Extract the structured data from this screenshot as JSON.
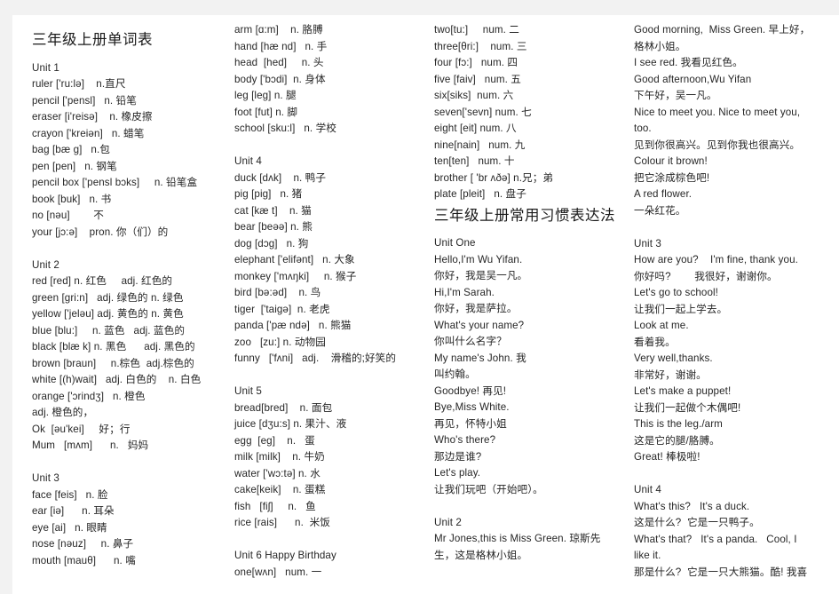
{
  "document": {
    "title_words": "三年级上册单词表",
    "title_phrases": "三年级上册常用习惯表达法"
  },
  "columns": {
    "col1": {
      "title": "三年级上册单词表",
      "blocks": [
        {
          "unit": "Unit 1",
          "lines": [
            "ruler ['ru:lə]    n.直尺",
            "pencil ['pensl]   n. 铅笔",
            "eraser [i'reisə]    n. 橡皮擦",
            "crayon ['kreiən]   n. 蜡笔",
            "bag [bæ g]   n.包",
            "pen [pen]   n. 钢笔",
            "pencil box ['pensl bɔks]     n. 铅笔盒",
            "book [buk]   n. 书",
            "no [nəu]        不",
            "your [jɔ:ə]    pron. 你（们）的"
          ]
        },
        {
          "unit": "Unit 2",
          "lines": [
            "red [red] n. 红色     adj. 红色的",
            "green [gri:n]   adj. 绿色的 n. 绿色",
            "yellow ['jeləu] adj. 黄色的 n. 黄色",
            "blue [blu:]     n. 蓝色   adj. 蓝色的",
            "black [blæ k] n. 黑色      adj. 黑色的",
            "brown [braun]     n.棕色  adj.棕色的",
            "white [(h)wait]   adj. 白色的    n. 白色",
            "orange ['ɔrindʒ]   n. 橙色",
            "adj. 橙色的，",
            "Ok  [əu'kei]     好；行",
            "Mum   [mʌm]      n.   妈妈"
          ]
        },
        {
          "unit": "Unit 3",
          "lines": [
            "face [feis]   n. 脸",
            "ear [iə]      n. 耳朵",
            "eye [ai]   n. 眼睛",
            "nose [nəuz]     n. 鼻子",
            "mouth [mauθ]      n. 嘴"
          ]
        }
      ]
    },
    "col2": {
      "blocks": [
        {
          "unit": "",
          "lines": [
            "arm [ɑ:m]    n. 胳膊",
            "hand [hæ nd]   n. 手",
            "head  [hed]     n. 头",
            "body ['bɔdi]  n. 身体",
            "leg [leg] n. 腿",
            "foot [fut] n. 脚",
            "school [sku:l]   n. 学校"
          ]
        },
        {
          "unit": "Unit 4",
          "lines": [
            "duck [dʌk]    n. 鸭子",
            "pig [pig]   n. 猪",
            "cat [kæ t]    n. 猫",
            "bear [beəə] n. 熊",
            "dog [dɔg]   n. 狗",
            "elephant ['elifənt]   n. 大象",
            "monkey ['mʌŋki]     n. 猴子",
            "bird [bə:əd]    n. 鸟",
            "tiger  ['taigə]  n. 老虎",
            "panda ['pæ ndə]   n. 熊猫",
            "zoo   [zu:] n. 动物园",
            "funny   ['fʌni]   adj.    滑稽的;好笑的"
          ]
        },
        {
          "unit": "Unit 5",
          "lines": [
            "bread[bred]    n. 面包",
            "juice [dʒu:s] n. 果汁、液",
            "egg  [eg]    n.   蛋",
            "milk [milk]    n. 牛奶",
            "water ['wɔ:tə] n. 水",
            "cake[keik]    n. 蛋糕",
            "fish   [fiʃ]     n.   鱼",
            "rice [rais]      n.  米饭"
          ]
        },
        {
          "unit": "Unit 6 Happy Birthday",
          "lines": [
            "one[wʌn]   num. 一"
          ]
        }
      ]
    },
    "col3": {
      "title": "三年级上册常用习惯表达法",
      "blocks_top": [
        {
          "unit": "",
          "lines": [
            "two[tu:]     num. 二",
            "three[θri:]    num. 三",
            "four [fɔ:]   num. 四",
            "five [faiv]   num. 五",
            "six[siks]  num. 六",
            "seven['sevn] num. 七",
            "eight [eit] num. 八",
            "nine[nain]   num. 九",
            "ten[ten]   num. 十",
            "brother [ 'br ʌðə] n.兄；弟",
            "plate [pleit]   n. 盘子"
          ]
        }
      ],
      "blocks_bottom": [
        {
          "unit": "Unit One",
          "lines": [
            "Hello,I'm Wu Yifan.",
            "你好，我是吴一凡。",
            "Hi,I'm Sarah.",
            "你好，我是萨拉。",
            "What's your name?",
            "你叫什么名字？",
            "My name's John. 我",
            "叫约翰。",
            "Goodbye! 再见!",
            "Bye,Miss White.",
            "再见，怀特小姐",
            "Who's there?",
            "那边是谁?",
            "Let's play.",
            "让我们玩吧（开始吧）。"
          ]
        },
        {
          "unit": "Unit 2",
          "lines": [
            "Mr Jones,this is Miss Green. 琼斯先",
            "生，这是格林小姐。"
          ]
        }
      ]
    },
    "col4": {
      "blocks": [
        {
          "unit": "",
          "lines": [
            "Good morning,  Miss Green. 早上好，",
            "格林小姐。",
            "I see red. 我看见红色。",
            "Good afternoon,Wu Yifan",
            "下午好，吴一凡。",
            "Nice to meet you. Nice to meet you,",
            "too.",
            "见到你很高兴。见到你我也很高兴。",
            "Colour it brown!",
            "把它涂成棕色吧!",
            "A red flower.",
            "一朵红花。"
          ]
        },
        {
          "unit": "Unit 3",
          "lines": [
            "How are you?    I'm fine, thank you.",
            "你好吗?        我很好，谢谢你。",
            "Let's go to school!",
            "让我们一起上学去。",
            "Look at me.",
            "看着我。",
            "Very well,thanks.",
            "非常好，谢谢。",
            "Let's make a puppet!",
            "让我们一起做个木偶吧!",
            "This is the leg./arm",
            "这是它的腿/胳膊。",
            "Great! 棒极啦!"
          ]
        },
        {
          "unit": "Unit 4",
          "lines": [
            "What's this?   It's a duck.",
            "这是什么?  它是一只鸭子。",
            "What's that?   It's a panda.   Cool, I",
            "like it.",
            "那是什么?  它是一只大熊猫。酷! 我喜"
          ]
        }
      ]
    }
  },
  "colors": {
    "page_background": "#ffffff",
    "canvas_background": "#f2f2f2",
    "text": "#262626",
    "title": "#1a1a1a"
  }
}
